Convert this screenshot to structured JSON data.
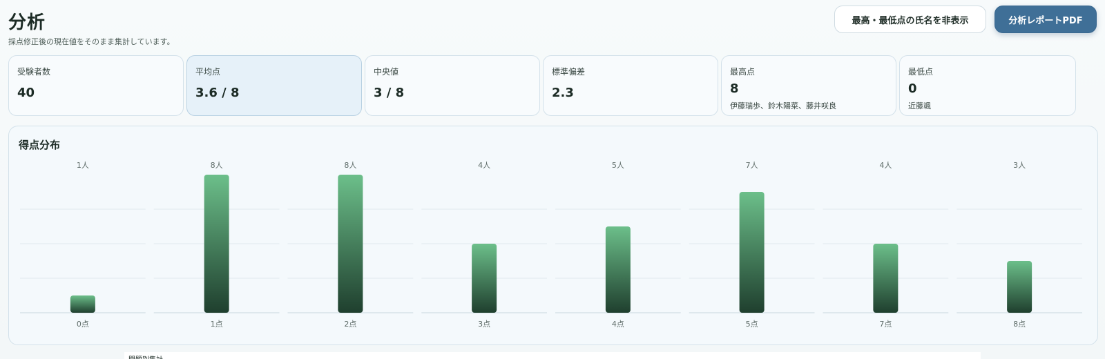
{
  "header": {
    "title": "分析",
    "subtitle": "採点修正後の現在値をそのまま集計しています。",
    "toggle_names_label": "最高・最低点の氏名を非表示",
    "pdf_label": "分析レポートPDF"
  },
  "stats": [
    {
      "label": "受験者数",
      "value": "40"
    },
    {
      "label": "平均点",
      "value": "3.6 / 8"
    },
    {
      "label": "中央値",
      "value": "3 / 8"
    },
    {
      "label": "標準偏差",
      "value": "2.3"
    },
    {
      "label": "最高点",
      "value": "8",
      "names": "伊藤瑞歩、鈴木陽菜、藤井咲良"
    },
    {
      "label": "最低点",
      "value": "0",
      "names": "近藤颯"
    }
  ],
  "chart_data": {
    "type": "bar",
    "title": "得点分布",
    "categories": [
      "0点",
      "1点",
      "2点",
      "3点",
      "4点",
      "5点",
      "7点",
      "8点"
    ],
    "values": [
      1,
      8,
      8,
      4,
      5,
      7,
      4,
      3
    ],
    "value_labels": [
      "1人",
      "8人",
      "8人",
      "4人",
      "5人",
      "7人",
      "4人",
      "3人"
    ],
    "ylim": [
      0,
      8
    ],
    "grid": true,
    "colors": {
      "bar_top": "#6cbf8a",
      "bar_bottom": "#1f3f2e",
      "grid": "#e1e9ee",
      "baseline": "#c9d6de"
    }
  },
  "bottom": {
    "label": "問題別集計"
  }
}
